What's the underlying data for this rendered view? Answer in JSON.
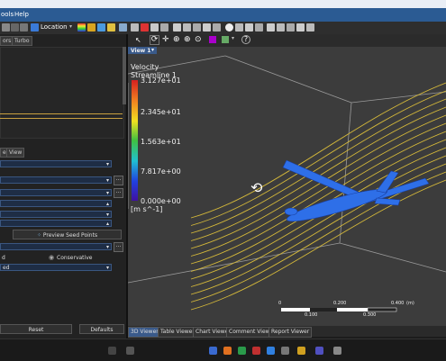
{
  "menubar": {
    "partial_item": "ools",
    "help": "Help"
  },
  "toolbar": {
    "location_label": "Location"
  },
  "left_panel": {
    "tabs": [
      "ors",
      "Turbo"
    ],
    "lower_tabs": [
      "e",
      "View"
    ],
    "preview_seed_button": "Preview Seed Points",
    "radio_left": "d",
    "radio_conservative": "Conservative",
    "dropdown_value": "ed",
    "reset_button": "Reset",
    "defaults_button": "Defaults"
  },
  "viewer": {
    "tab_title": "View 1",
    "legend": {
      "variable": "Velocity",
      "object": "Streamline 1",
      "ticks": [
        "3.127e+01",
        "2.345e+01",
        "1.563e+01",
        "7.817e+00",
        "0.000e+00"
      ],
      "unit": "[m s^-1]",
      "colors": [
        "#d62020",
        "#f08020",
        "#f0e020",
        "#40c040",
        "#20c0d0",
        "#2040e0",
        "#4010a0"
      ]
    },
    "scale": {
      "labels_top": [
        "0",
        "0.200",
        "0.400",
        "(m)"
      ],
      "labels_bottom": [
        "0.100",
        "0.300"
      ]
    },
    "streamline_color": "#d4b83a",
    "aircraft_color": "#2e6fe8"
  },
  "bottom_tabs": [
    "3D Viewer",
    "Table Viewer",
    "Chart Viewer",
    "Comment Viewer",
    "Report Viewer"
  ]
}
